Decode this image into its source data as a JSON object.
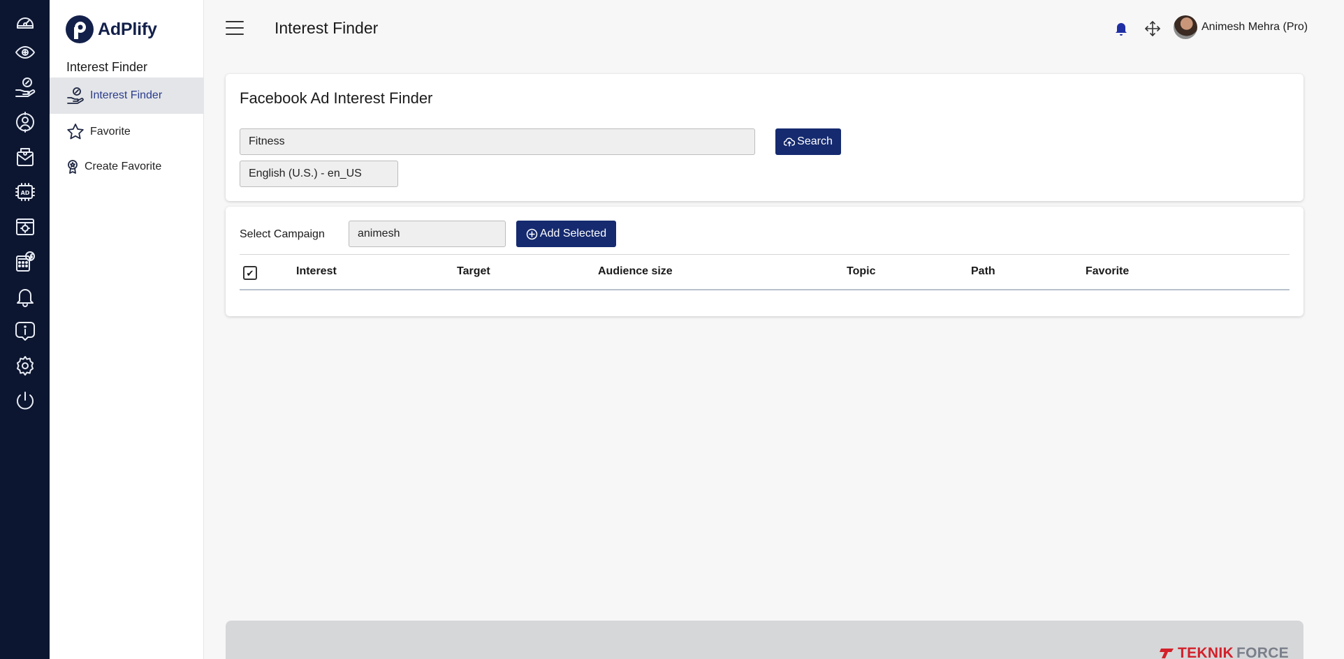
{
  "rail": {
    "icons": [
      "dashboard-icon",
      "eye-icon",
      "hand-coin-icon",
      "user-support-icon",
      "mail-icon",
      "ad-icon",
      "browser-icon",
      "calculator-facebook-icon",
      "bell-icon",
      "info-icon",
      "settings-icon",
      "power-icon"
    ]
  },
  "sidebar": {
    "brand": "AdPlify",
    "section_title": "Interest Finder",
    "items": [
      {
        "label": "Interest Finder",
        "icon": "hand-coin-icon",
        "active": true
      },
      {
        "label": "Favorite",
        "icon": "star-icon",
        "active": false
      },
      {
        "label": "Create Favorite",
        "icon": "award-icon",
        "active": false
      }
    ]
  },
  "header": {
    "title": "Interest Finder",
    "user_name": "Animesh Mehra (Pro)"
  },
  "finder": {
    "title": "Facebook Ad Interest Finder",
    "search_value": "Fitness",
    "search_button": "Search",
    "language_value": "English (U.S.) - en_US"
  },
  "campaign": {
    "label": "Select Campaign",
    "value": "animesh",
    "add_button": "Add Selected"
  },
  "table": {
    "columns": [
      "Interest",
      "Target",
      "Audience size",
      "Topic",
      "Path",
      "Favorite"
    ],
    "checkbox_checked": true
  },
  "footer": {
    "brand_part1": "TEKNIK",
    "brand_part2": "FORCE"
  },
  "colors": {
    "rail_bg": "#0d1630",
    "primary": "#152a6f",
    "active_item": "#2b3d8c",
    "bell": "#1f2fa3",
    "footer_red": "#d3202a"
  }
}
